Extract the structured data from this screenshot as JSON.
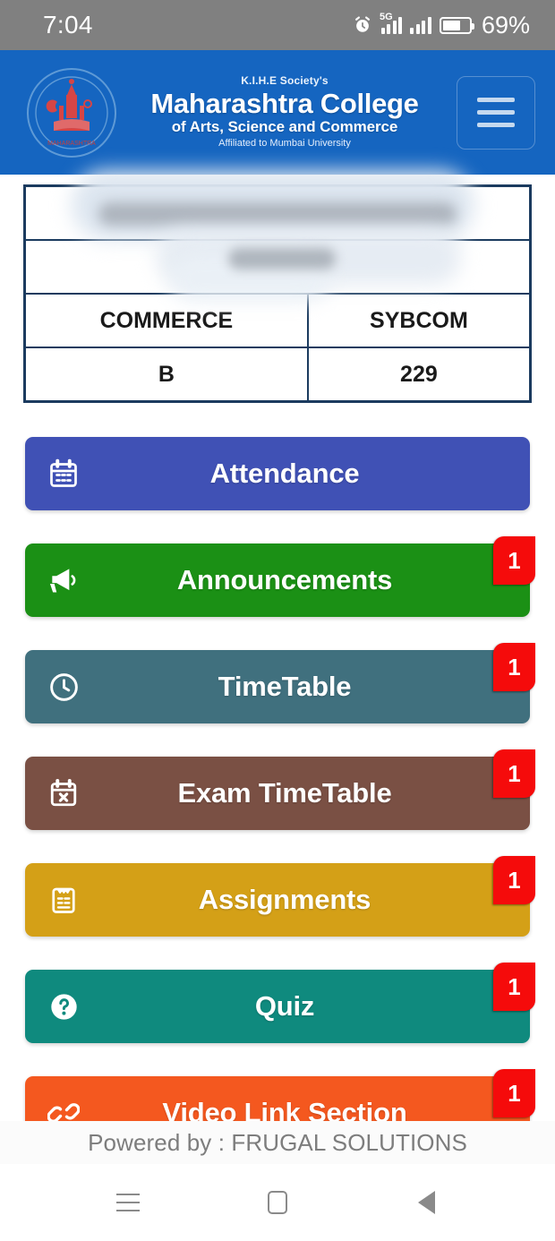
{
  "status_bar": {
    "time": "7:04",
    "battery_percent": "69%",
    "network_label": "5G",
    "icons": [
      "alarm-icon",
      "signal-5g-icon",
      "signal-icon",
      "battery-icon"
    ]
  },
  "header": {
    "society": "K.I.H.E Society's",
    "college_name": "Maharashtra College",
    "college_subtitle": "of Arts, Science and Commerce",
    "affiliation": "Affiliated to Mumbai University",
    "menu_icon": "hamburger-menu-icon",
    "background_color": "#1565c0"
  },
  "student_info": {
    "rows": [
      {
        "type": "single",
        "value": "",
        "redacted": true
      },
      {
        "type": "single",
        "value": "",
        "redacted": true
      },
      {
        "type": "pair",
        "left": "COMMERCE",
        "right": "SYBCOM",
        "redacted": false
      },
      {
        "type": "pair",
        "left": "B",
        "right": "229",
        "redacted": false
      }
    ],
    "border_color": "#1b3b5f"
  },
  "menu": {
    "items": [
      {
        "label": "Attendance",
        "icon": "calendar-icon",
        "color": "#4051b5",
        "badge": null
      },
      {
        "label": "Announcements",
        "icon": "megaphone-icon",
        "color": "#1b9015",
        "badge": "1"
      },
      {
        "label": "TimeTable",
        "icon": "clock-icon",
        "color": "#40707e",
        "badge": "1"
      },
      {
        "label": "Exam TimeTable",
        "icon": "calendar-x-icon",
        "color": "#7a5044",
        "badge": "1"
      },
      {
        "label": "Assignments",
        "icon": "clipboard-list-icon",
        "color": "#d4a017",
        "badge": "1"
      },
      {
        "label": "Quiz",
        "icon": "question-circle-icon",
        "color": "#0f8a7e",
        "badge": "1"
      },
      {
        "label": "Video Link Section",
        "icon": "link-chain-icon",
        "color": "#f4581f",
        "badge": "1"
      }
    ],
    "badge_color": "#f50b0b"
  },
  "footer": {
    "powered_by": "Powered by : FRUGAL SOLUTIONS"
  },
  "navigation_bar": {
    "recents": "recents-icon",
    "home": "home-icon",
    "back": "back-icon"
  }
}
